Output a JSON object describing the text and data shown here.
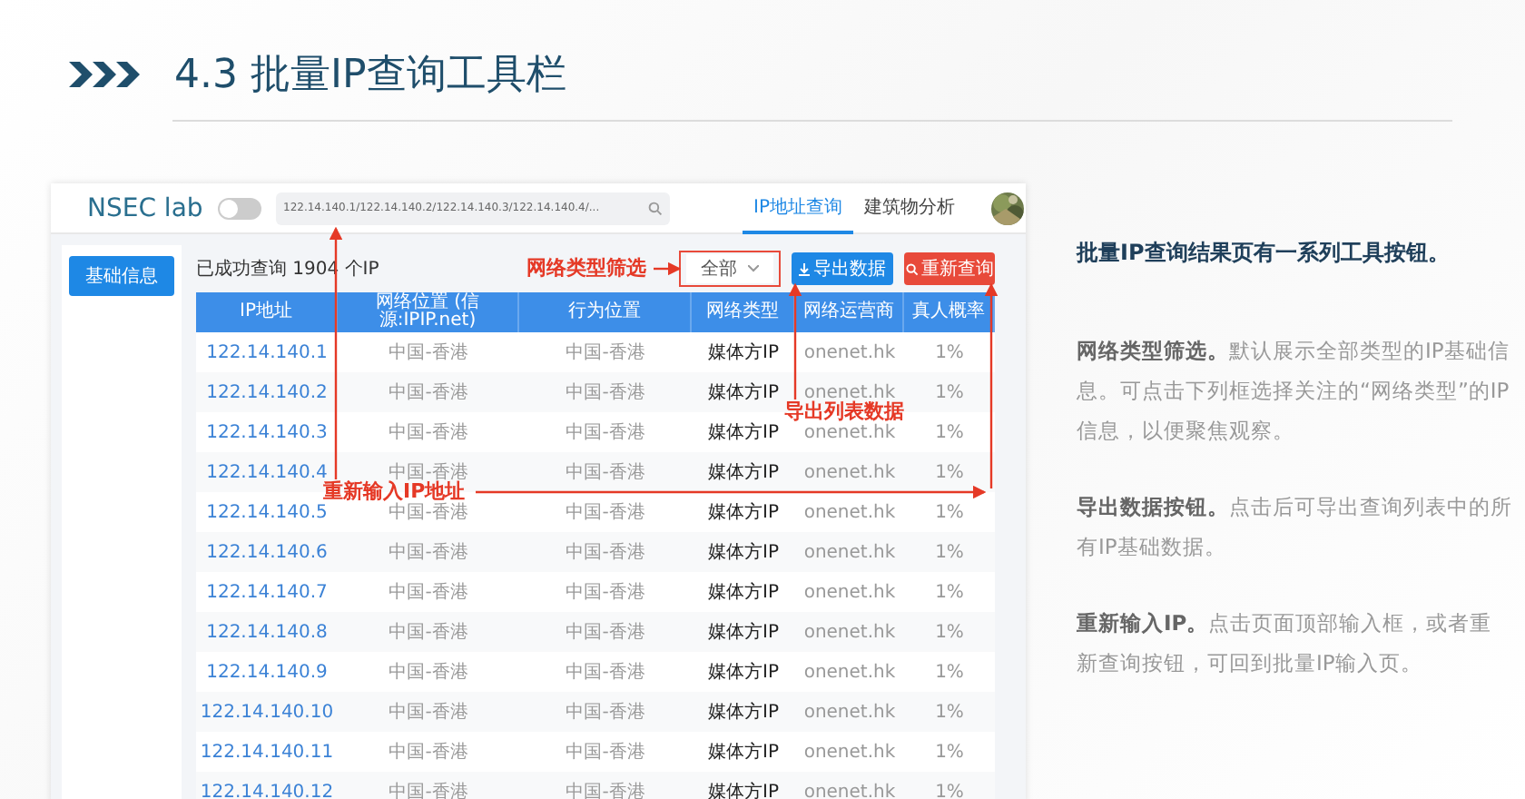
{
  "slide_title": {
    "number": "4.3",
    "text": "批量IP查询工具栏"
  },
  "app": {
    "logo": "NSEC lab",
    "toggle": {
      "on": false
    },
    "search": {
      "value": "122.14.140.1/122.14.140.2/122.14.140.3/122.14.140.4/..."
    },
    "nav_tabs": [
      {
        "label": "IP地址查询",
        "selected": true
      },
      {
        "label": "建筑物分析",
        "selected": false
      }
    ],
    "sidebar": {
      "items": [
        {
          "label": "基础信息",
          "selected": true
        }
      ]
    },
    "result_count": "已成功查询 1904 个IP",
    "filter": {
      "value": "全部"
    },
    "buttons": [
      {
        "label": "导出数据",
        "kind": "export"
      },
      {
        "label": "重新查询",
        "kind": "requery"
      }
    ],
    "table": {
      "columns": [
        "IP地址",
        "网络位置 (信源:IPIP.net)",
        "行为位置",
        "网络类型",
        "网络运营商",
        "真人概率"
      ],
      "rows": [
        [
          "122.14.140.1",
          "中国-香港",
          "中国-香港",
          "媒体方IP",
          "onenet.hk",
          "1%"
        ],
        [
          "122.14.140.2",
          "中国-香港",
          "中国-香港",
          "媒体方IP",
          "onenet.hk",
          "1%"
        ],
        [
          "122.14.140.3",
          "中国-香港",
          "中国-香港",
          "媒体方IP",
          "onenet.hk",
          "1%"
        ],
        [
          "122.14.140.4",
          "中国-香港",
          "中国-香港",
          "媒体方IP",
          "onenet.hk",
          "1%"
        ],
        [
          "122.14.140.5",
          "中国-香港",
          "中国-香港",
          "媒体方IP",
          "onenet.hk",
          "1%"
        ],
        [
          "122.14.140.6",
          "中国-香港",
          "中国-香港",
          "媒体方IP",
          "onenet.hk",
          "1%"
        ],
        [
          "122.14.140.7",
          "中国-香港",
          "中国-香港",
          "媒体方IP",
          "onenet.hk",
          "1%"
        ],
        [
          "122.14.140.8",
          "中国-香港",
          "中国-香港",
          "媒体方IP",
          "onenet.hk",
          "1%"
        ],
        [
          "122.14.140.9",
          "中国-香港",
          "中国-香港",
          "媒体方IP",
          "onenet.hk",
          "1%"
        ],
        [
          "122.14.140.10",
          "中国-香港",
          "中国-香港",
          "媒体方IP",
          "onenet.hk",
          "1%"
        ],
        [
          "122.14.140.11",
          "中国-香港",
          "中国-香港",
          "媒体方IP",
          "onenet.hk",
          "1%"
        ],
        [
          "122.14.140.12",
          "中国-香港",
          "中国-香港",
          "媒体方IP",
          "onenet.hk",
          "1%"
        ]
      ]
    }
  },
  "annotations": [
    {
      "label": "网络类型筛选",
      "kind": "filter"
    },
    {
      "label": "导出列表数据",
      "kind": "export"
    },
    {
      "label": "重新输入IP地址",
      "kind": "reinput"
    }
  ],
  "description": {
    "title": "批量IP查询结果页有一系列工具按钮。",
    "paragraphs": [
      "**网络类型筛选。**默认展示全部类型的IP基础信息。可点击下列框选择关注的“网络类型”的IP信息，以便聚焦观察。",
      "**导出数据按钮。**点击后可导出查询列表中的所有IP基础数据。",
      "**重新输入IP。**点击页面顶部输入框，或者重新查询按钮，可回到批量IP输入页。"
    ]
  }
}
